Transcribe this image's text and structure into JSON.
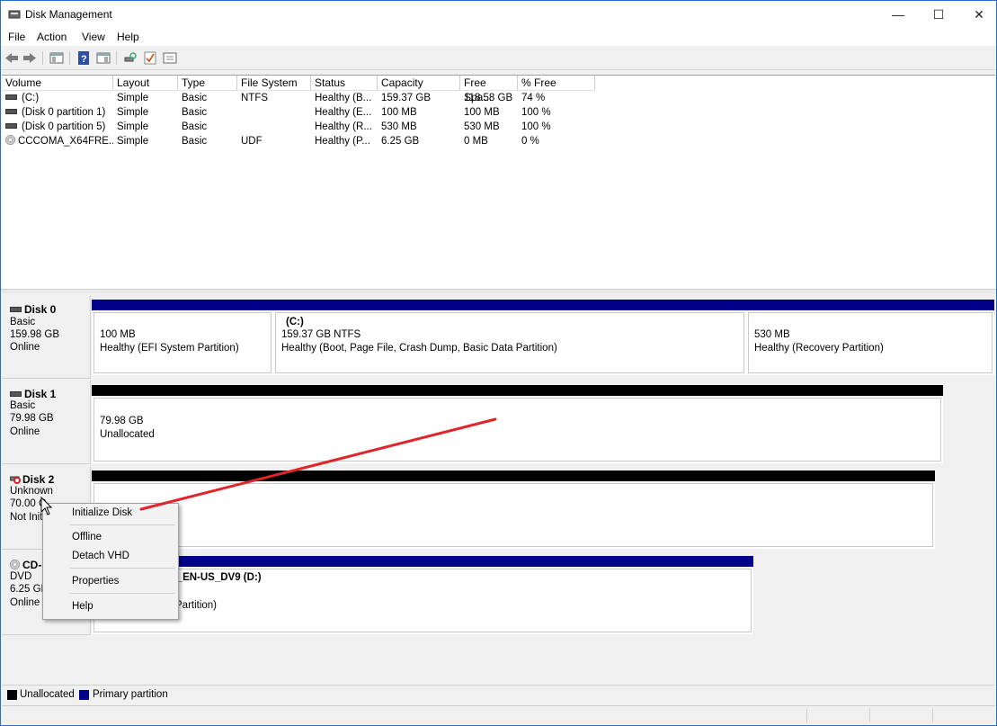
{
  "window": {
    "title": "Disk Management",
    "controls": {
      "minimize": "—",
      "maximize": "☐",
      "close": "✕"
    }
  },
  "menu": [
    "File",
    "Action",
    "View",
    "Help"
  ],
  "toolbar": {
    "icons": [
      "back-icon",
      "forward-icon",
      "show-hide-tree-icon",
      "help-icon",
      "properties-icon",
      "rescan-disks-icon",
      "check-icon",
      "console-icon"
    ]
  },
  "volume_list": {
    "columns": [
      "Volume",
      "Layout",
      "Type",
      "File System",
      "Status",
      "Capacity",
      "Free Spa...",
      "% Free"
    ],
    "rows": [
      {
        "icon": "drive-icon",
        "volume": "(C:)",
        "layout": "Simple",
        "type": "Basic",
        "fs": "NTFS",
        "status": "Healthy (B...",
        "capacity": "159.37 GB",
        "free": "118.58 GB",
        "pct": "74 %"
      },
      {
        "icon": "drive-icon",
        "volume": "(Disk 0 partition 1)",
        "layout": "Simple",
        "type": "Basic",
        "fs": "",
        "status": "Healthy (E...",
        "capacity": "100 MB",
        "free": "100 MB",
        "pct": "100 %"
      },
      {
        "icon": "drive-icon",
        "volume": "(Disk 0 partition 5)",
        "layout": "Simple",
        "type": "Basic",
        "fs": "",
        "status": "Healthy (R...",
        "capacity": "530 MB",
        "free": "530 MB",
        "pct": "100 %"
      },
      {
        "icon": "cd-icon",
        "volume": "CCCOMA_X64FRE...",
        "layout": "Simple",
        "type": "Basic",
        "fs": "UDF",
        "status": "Healthy (P...",
        "capacity": "6.25 GB",
        "free": "0 MB",
        "pct": "0 %"
      }
    ]
  },
  "disks": [
    {
      "name": "Disk 0",
      "type": "Basic",
      "size": "159.98 GB",
      "state": "Online",
      "partitions": [
        {
          "line1": "100 MB",
          "line2": "Healthy (EFI System Partition)"
        },
        {
          "title": "(C:)",
          "line1": "159.37 GB NTFS",
          "line2": "Healthy (Boot, Page File, Crash Dump, Basic Data Partition)"
        },
        {
          "line1": "530 MB",
          "line2": "Healthy (Recovery Partition)"
        }
      ]
    },
    {
      "name": "Disk 1",
      "type": "Basic",
      "size": "79.98 GB",
      "state": "Online",
      "partitions": [
        {
          "line1": "79.98 GB",
          "line2": "Unallocated"
        }
      ]
    },
    {
      "name": "Disk 2",
      "type": "Unknown",
      "size": "70.00 G",
      "state": "Not Init",
      "partitions": []
    },
    {
      "name": "CD-",
      "type": "DVD",
      "size": "6.25 GB",
      "state": "Online",
      "partitions": [
        {
          "title": "E_EN-US_DV9  (D:)",
          "line2": "Partition)"
        }
      ]
    }
  ],
  "context_menu": {
    "items": [
      "Initialize Disk",
      "Offline",
      "Detach VHD",
      "Properties",
      "Help"
    ]
  },
  "legend": [
    {
      "label": "Unallocated",
      "color": "#000000"
    },
    {
      "label": "Primary partition",
      "color": "#00008b"
    }
  ],
  "colors": {
    "primary": "#00008b",
    "unallocated": "#000000",
    "annotation": "#e0242a"
  }
}
